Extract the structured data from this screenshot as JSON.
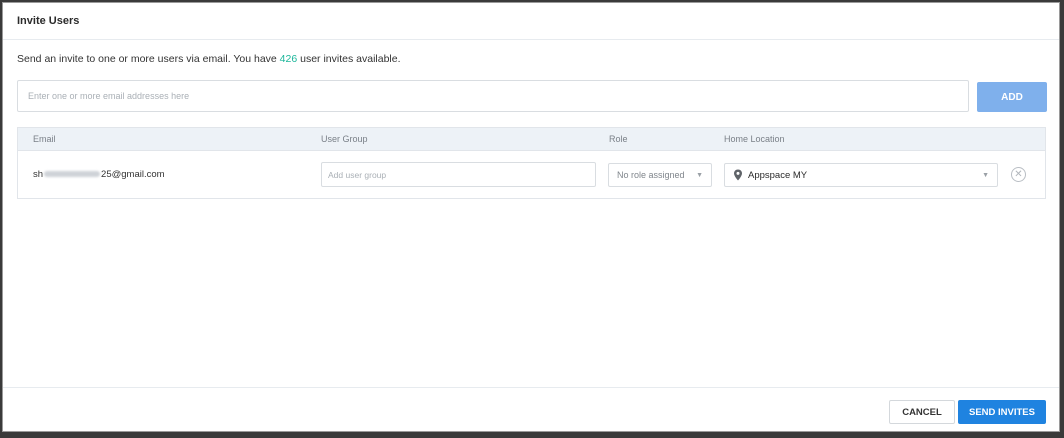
{
  "dialog": {
    "title": "Invite Users"
  },
  "intro": {
    "prefix": "Send an invite to one or more users via email. You have ",
    "count": "426",
    "suffix": " user invites available."
  },
  "email_input": {
    "placeholder": "Enter one or more email addresses here",
    "value": ""
  },
  "add_button": {
    "label": "ADD"
  },
  "table": {
    "columns": [
      "Email",
      "User Group",
      "Role",
      "Home Location"
    ],
    "rows": [
      {
        "email_prefix": "sh",
        "email_suffix": "25@gmail.com",
        "user_group_placeholder": "Add user group",
        "role": "No role assigned",
        "home_location": "Appspace MY"
      }
    ]
  },
  "footer": {
    "cancel_label": "CANCEL",
    "send_label": "SEND INVITES"
  },
  "colors": {
    "accent": "#1f83e0",
    "add_button": "#7fb0ec",
    "count_text": "#1bb69a",
    "table_header_bg": "#edf2f7"
  }
}
